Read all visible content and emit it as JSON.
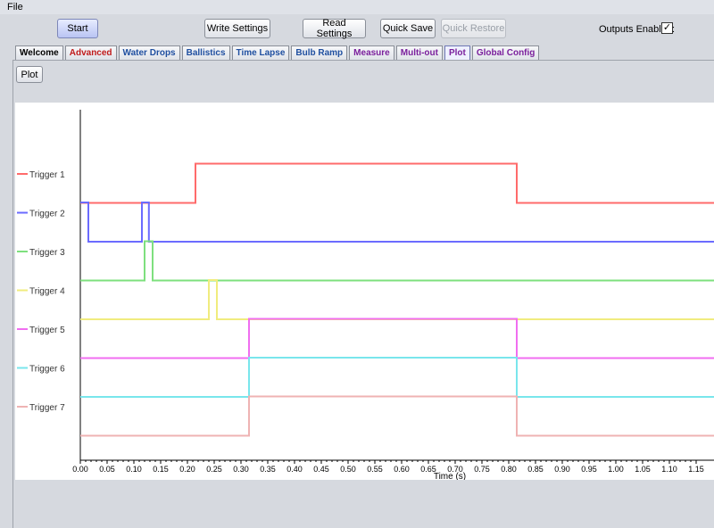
{
  "menu": {
    "file_label": "File"
  },
  "toolbar": {
    "start": "Start",
    "write_settings": "Write Settings",
    "read_settings": "Read Settings",
    "quick_save": "Quick Save",
    "quick_restore": "Quick Restore",
    "outputs_enabled_label": "Outputs Enabled:",
    "outputs_enabled": true
  },
  "tabs": [
    {
      "label": "Welcome",
      "color": "#000000"
    },
    {
      "label": "Advanced",
      "color": "#c01b1b"
    },
    {
      "label": "Water Drops",
      "color": "#1f4fa0"
    },
    {
      "label": "Ballistics",
      "color": "#1f4fa0"
    },
    {
      "label": "Time Lapse",
      "color": "#1f4fa0"
    },
    {
      "label": "Bulb Ramp",
      "color": "#1f4fa0"
    },
    {
      "label": "Measure",
      "color": "#7a1f9c"
    },
    {
      "label": "Multi-out",
      "color": "#7a1f9c"
    },
    {
      "label": "Plot",
      "color": "#7a1f9c",
      "active": true
    },
    {
      "label": "Global Config",
      "color": "#7a1f9c"
    }
  ],
  "plot_button": "Plot",
  "chart_data": {
    "type": "line",
    "xlabel": "Time (s)",
    "xlim": [
      0,
      1.18
    ],
    "xticks": [
      "0.00",
      "0.05",
      "0.10",
      "0.15",
      "0.20",
      "0.25",
      "0.30",
      "0.35",
      "0.40",
      "0.45",
      "0.50",
      "0.55",
      "0.60",
      "0.65",
      "0.70",
      "0.75",
      "0.80",
      "0.85",
      "0.90",
      "0.95",
      "1.00",
      "1.05",
      "1.10",
      "1.15"
    ],
    "series": [
      {
        "name": "Trigger 1",
        "color": "#ff6b6b",
        "pulses": [
          [
            0.215,
            0.815
          ]
        ]
      },
      {
        "name": "Trigger 2",
        "color": "#6b6bff",
        "pulses": [
          [
            0.0,
            0.015
          ],
          [
            0.115,
            0.128
          ]
        ]
      },
      {
        "name": "Trigger 3",
        "color": "#7ee07e",
        "pulses": [
          [
            0.12,
            0.135
          ]
        ]
      },
      {
        "name": "Trigger 4",
        "color": "#f0ec7e",
        "pulses": [
          [
            0.24,
            0.255
          ]
        ]
      },
      {
        "name": "Trigger 5",
        "color": "#f06ef0",
        "pulses": [
          [
            0.315,
            0.815
          ]
        ]
      },
      {
        "name": "Trigger 6",
        "color": "#79e6ec",
        "pulses": [
          [
            0.315,
            0.815
          ]
        ]
      },
      {
        "name": "Trigger 7",
        "color": "#efb3b3",
        "pulses": [
          [
            0.315,
            0.815
          ]
        ]
      }
    ]
  }
}
